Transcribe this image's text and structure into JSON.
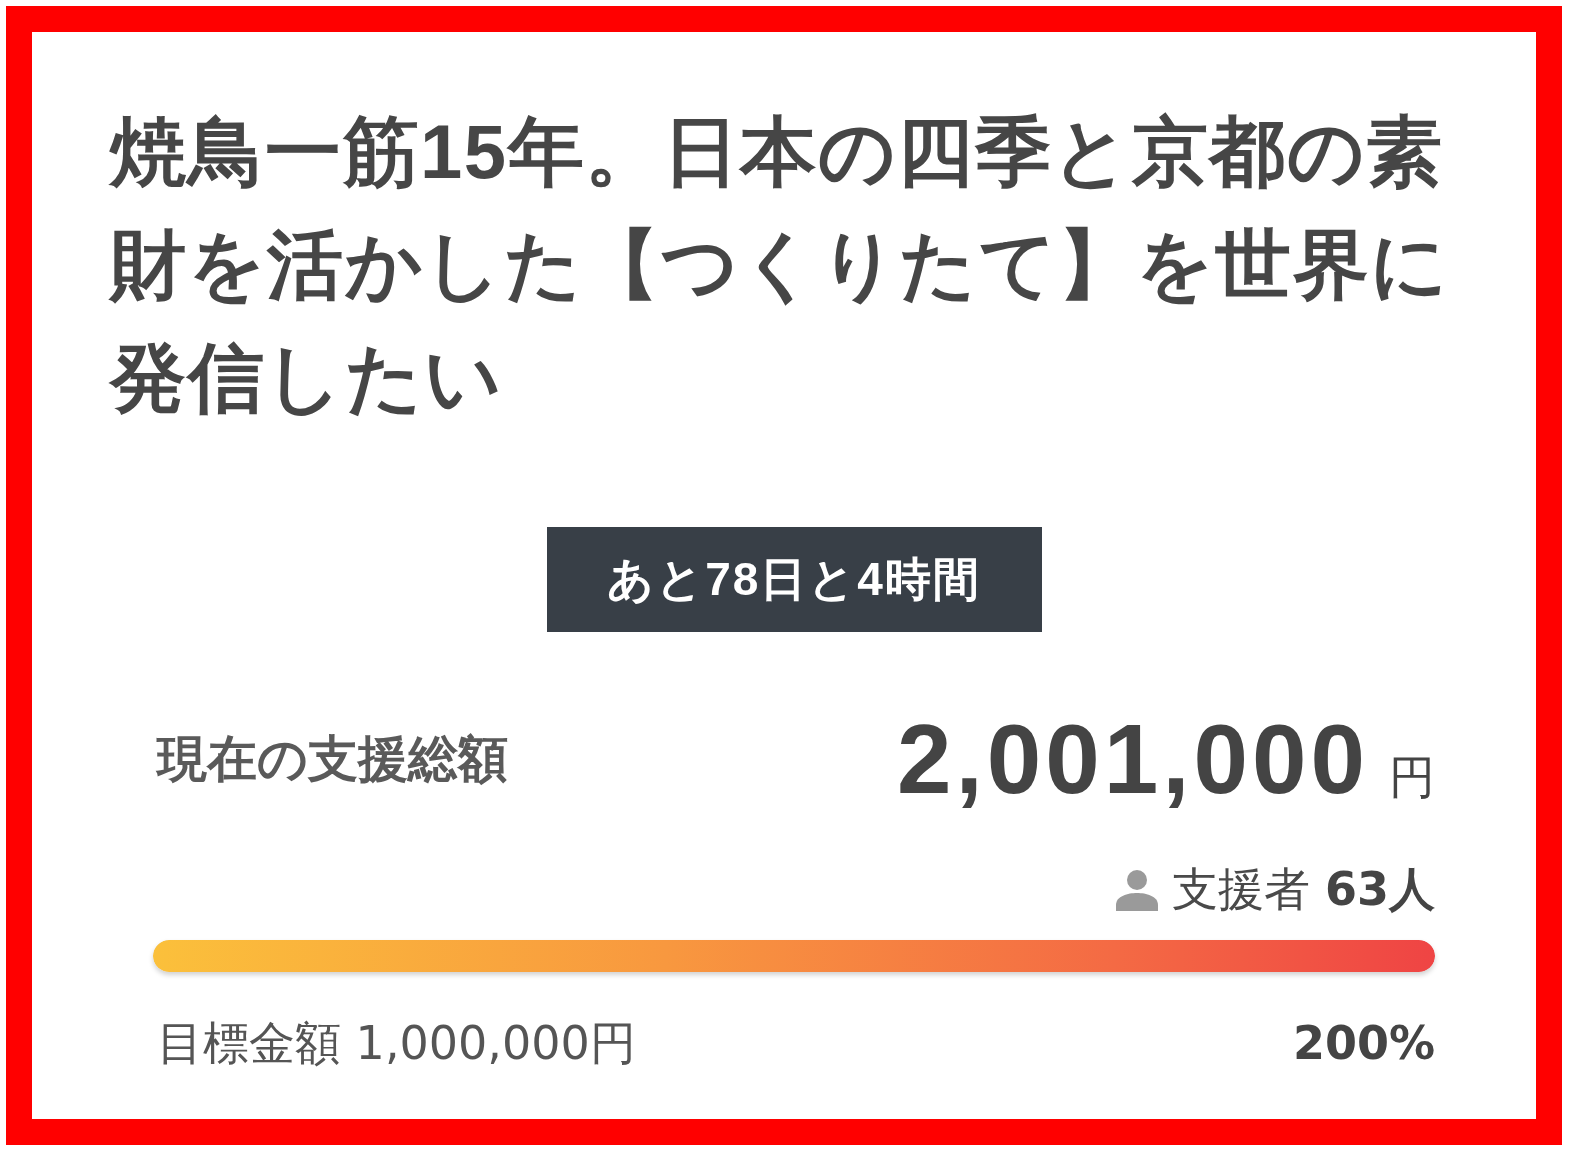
{
  "project": {
    "title": "焼鳥一筋15年。日本の四季と京都の素財を活かした【つくりたて】を世界に発信したい",
    "time_left": "あと78日と4時間",
    "total_label": "現在の支援総額",
    "total_amount": "2,001,000",
    "total_unit": "円",
    "supporters": "支援者 **63人**",
    "progress": {
      "level": 1
    },
    "goal": "目標金額 1,000,000円",
    "percent": "200%"
  }
}
